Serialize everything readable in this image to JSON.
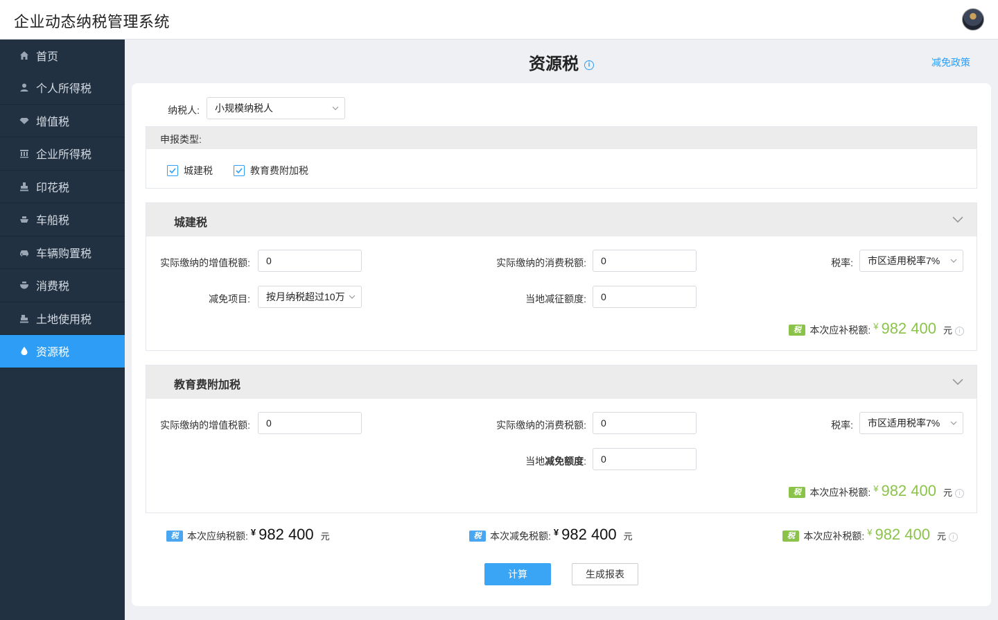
{
  "app": {
    "title": "企业动态纳税管理系统"
  },
  "sidebar": {
    "items": [
      {
        "label": "首页",
        "icon": "home-icon"
      },
      {
        "label": "个人所得税",
        "icon": "user-icon"
      },
      {
        "label": "增值税",
        "icon": "diamond-icon"
      },
      {
        "label": "企业所得税",
        "icon": "building-icon"
      },
      {
        "label": "印花税",
        "icon": "stamp-icon"
      },
      {
        "label": "车船税",
        "icon": "ship-icon"
      },
      {
        "label": "车辆购置税",
        "icon": "car-icon"
      },
      {
        "label": "消费税",
        "icon": "bowl-icon"
      },
      {
        "label": "土地使用税",
        "icon": "land-icon"
      },
      {
        "label": "资源税",
        "icon": "water-drop-icon",
        "active": true
      }
    ]
  },
  "page": {
    "title": "资源税",
    "policy_link": "减免政策"
  },
  "form": {
    "taxpayer_label": "纳税人:",
    "taxpayer_value": "小规模纳税人",
    "report_type_label": "申报类型:",
    "report_types": [
      {
        "label": "城建税",
        "checked": true
      },
      {
        "label": "教育费附加税",
        "checked": true
      }
    ]
  },
  "sections": {
    "urban": {
      "title": "城建税",
      "vat_label": "实际缴纳的增值税额:",
      "vat_value": "0",
      "consumption_label": "实际缴纳的消费税额:",
      "consumption_value": "0",
      "rate_label": "税率:",
      "rate_value": "市区适用税率7%",
      "exemption_label": "减免项目:",
      "exemption_value": "按月纳税超过10万",
      "local_label": "当地减征额度:",
      "local_value": "0",
      "supplement_label": "本次应补税额:",
      "supplement_amount": "982 400",
      "currency_symbol": "¥",
      "unit": "元"
    },
    "education": {
      "title": "教育费附加税",
      "vat_label": "实际缴纳的增值税额:",
      "vat_value": "0",
      "consumption_label": "实际缴纳的消费税额:",
      "consumption_value": "0",
      "rate_label": "税率:",
      "rate_value": "市区适用税率7%",
      "local_label_normal": "当地",
      "local_label_bold": "减免额度",
      "local_label_colon": ":",
      "local_value": "0",
      "supplement_label": "本次应补税额:",
      "supplement_amount": "982 400",
      "currency_symbol": "¥",
      "unit": "元"
    }
  },
  "summary": {
    "badge_text": "税",
    "payable_label": "本次应纳税额:",
    "payable_amount": "982 400",
    "exempt_label": "本次减免税额:",
    "exempt_amount": "982 400",
    "supplement_label": "本次应补税额:",
    "supplement_amount": "982 400",
    "currency_symbol": "¥",
    "unit": "元"
  },
  "actions": {
    "calculate": "计算",
    "generate_report": "生成报表"
  },
  "colors": {
    "accent": "#2e9df5",
    "sidebar_bg": "#223142",
    "green": "#8bc34a",
    "badge_blue": "#4aa6f0"
  }
}
